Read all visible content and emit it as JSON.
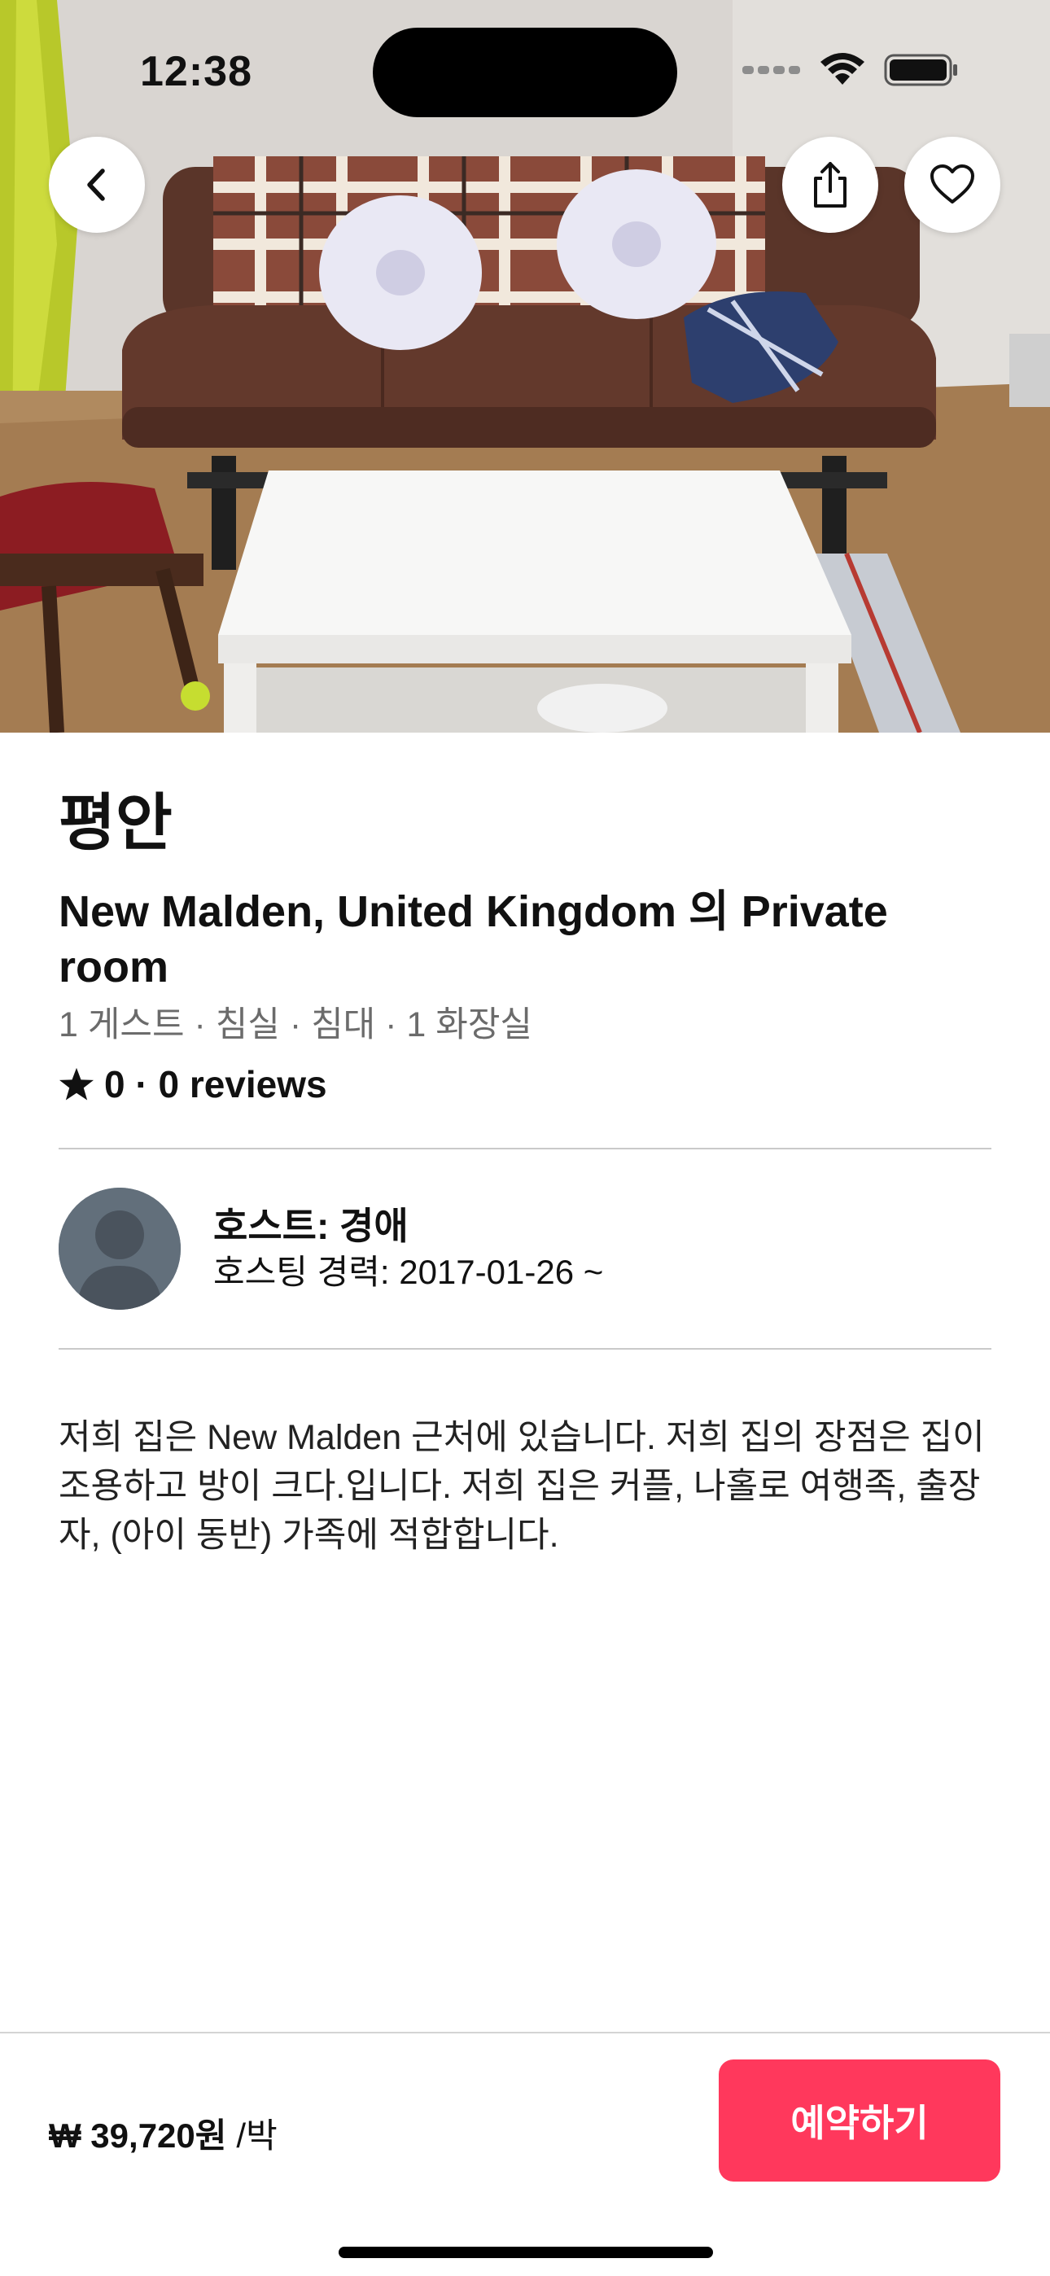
{
  "status_bar": {
    "time": "12:38"
  },
  "hero": {
    "photo_description": "",
    "back_icon": "chevron-left-icon",
    "share_icon": "share-icon",
    "favorite_icon": "heart-icon"
  },
  "listing": {
    "name": "평안",
    "subtitle": "New Malden, United Kingdom 의 Private room",
    "facts": "1 게스트 ·  침실 ·  침대 · 1 화장실",
    "rating_icon": "star-icon",
    "rating_text": "0 · 0 reviews"
  },
  "host": {
    "name": "호스트: 경애",
    "since": "호스팅 경력: 2017-01-26 ~"
  },
  "description": "저희 집은 New Malden  근처에 있습니다. 저희 집의 장점은 집이 조용하고 방이 크다.입니다. 저희 집은 커플, 나홀로 여행족, 출장자, (아이 동반) 가족에 적합합니다.",
  "booking": {
    "price": "₩ 39,720원",
    "per_night": "/박",
    "reserve_label": "예약하기"
  },
  "colors": {
    "accent": "#ff385c",
    "avatar": "#626f7b",
    "divider": "#c9c9c9"
  }
}
